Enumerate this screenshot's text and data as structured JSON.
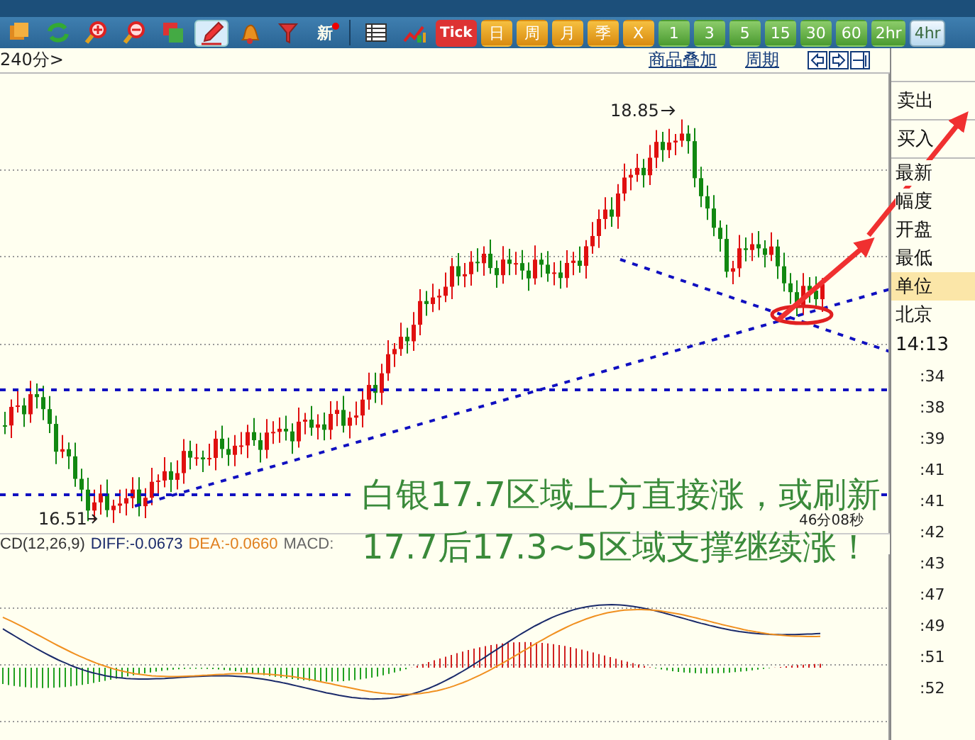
{
  "toolbar": {
    "items": [
      {
        "kind": "icon",
        "selected": false
      },
      {
        "kind": "icon",
        "selected": false
      },
      {
        "kind": "icon",
        "selected": false
      },
      {
        "kind": "icon",
        "selected": false
      },
      {
        "kind": "icon",
        "selected": false
      },
      {
        "kind": "icon",
        "selected": true
      },
      {
        "kind": "icon",
        "selected": false
      },
      {
        "kind": "icon",
        "selected": false
      },
      {
        "kind": "news",
        "label": "新",
        "selected": false
      },
      {
        "kind": "icon",
        "selected": false
      },
      {
        "kind": "icon",
        "selected": false
      },
      {
        "kind": "tick",
        "label": "Tick",
        "selected": false
      },
      {
        "kind": "period",
        "label": "日",
        "selected": false
      },
      {
        "kind": "period",
        "label": "周",
        "selected": false
      },
      {
        "kind": "period",
        "label": "月",
        "selected": false
      },
      {
        "kind": "period",
        "label": "季",
        "selected": false
      },
      {
        "kind": "period",
        "label": "X",
        "selected": false
      },
      {
        "kind": "minute",
        "label": "1",
        "selected": false
      },
      {
        "kind": "minute",
        "label": "3",
        "selected": false
      },
      {
        "kind": "minute",
        "label": "5",
        "selected": false
      },
      {
        "kind": "minute",
        "label": "15",
        "selected": false
      },
      {
        "kind": "minute",
        "label": "30",
        "selected": false
      },
      {
        "kind": "minute",
        "label": "60",
        "selected": false
      },
      {
        "kind": "minute",
        "label": "2hr",
        "selected": false
      },
      {
        "kind": "minute",
        "label": "4hr",
        "selected": true
      }
    ]
  },
  "header": {
    "period": "240分>",
    "links": [
      "商品叠加",
      "周期"
    ]
  },
  "chart": {
    "high_label": "18.85",
    "low_label": "16.51",
    "timer": "46分08秒",
    "annotation": [
      "白银17.7区域上方直接涨，或刷新",
      "17.7后17.3~5区域支撑继续涨！"
    ]
  },
  "macd": {
    "title": "CD(12,26,9)",
    "diff": "DIFF:-0.0673",
    "dea": "DEA:-0.0660",
    "macd": "MACD:"
  },
  "side_panel": {
    "quotes": [
      "卖出",
      "买入"
    ],
    "fields": [
      {
        "label": "最新",
        "selected": false
      },
      {
        "label": "幅度",
        "selected": false
      },
      {
        "label": "开盘",
        "selected": false
      },
      {
        "label": "最低",
        "selected": false
      },
      {
        "label": "单位",
        "selected": true
      },
      {
        "label": "北京",
        "selected": false
      }
    ],
    "time": "14:13",
    "ticks": [
      ":34",
      ":38",
      ":39",
      ":41",
      ":41",
      ":42",
      ":43",
      ":47",
      ":49",
      ":51",
      ":52"
    ]
  }
}
